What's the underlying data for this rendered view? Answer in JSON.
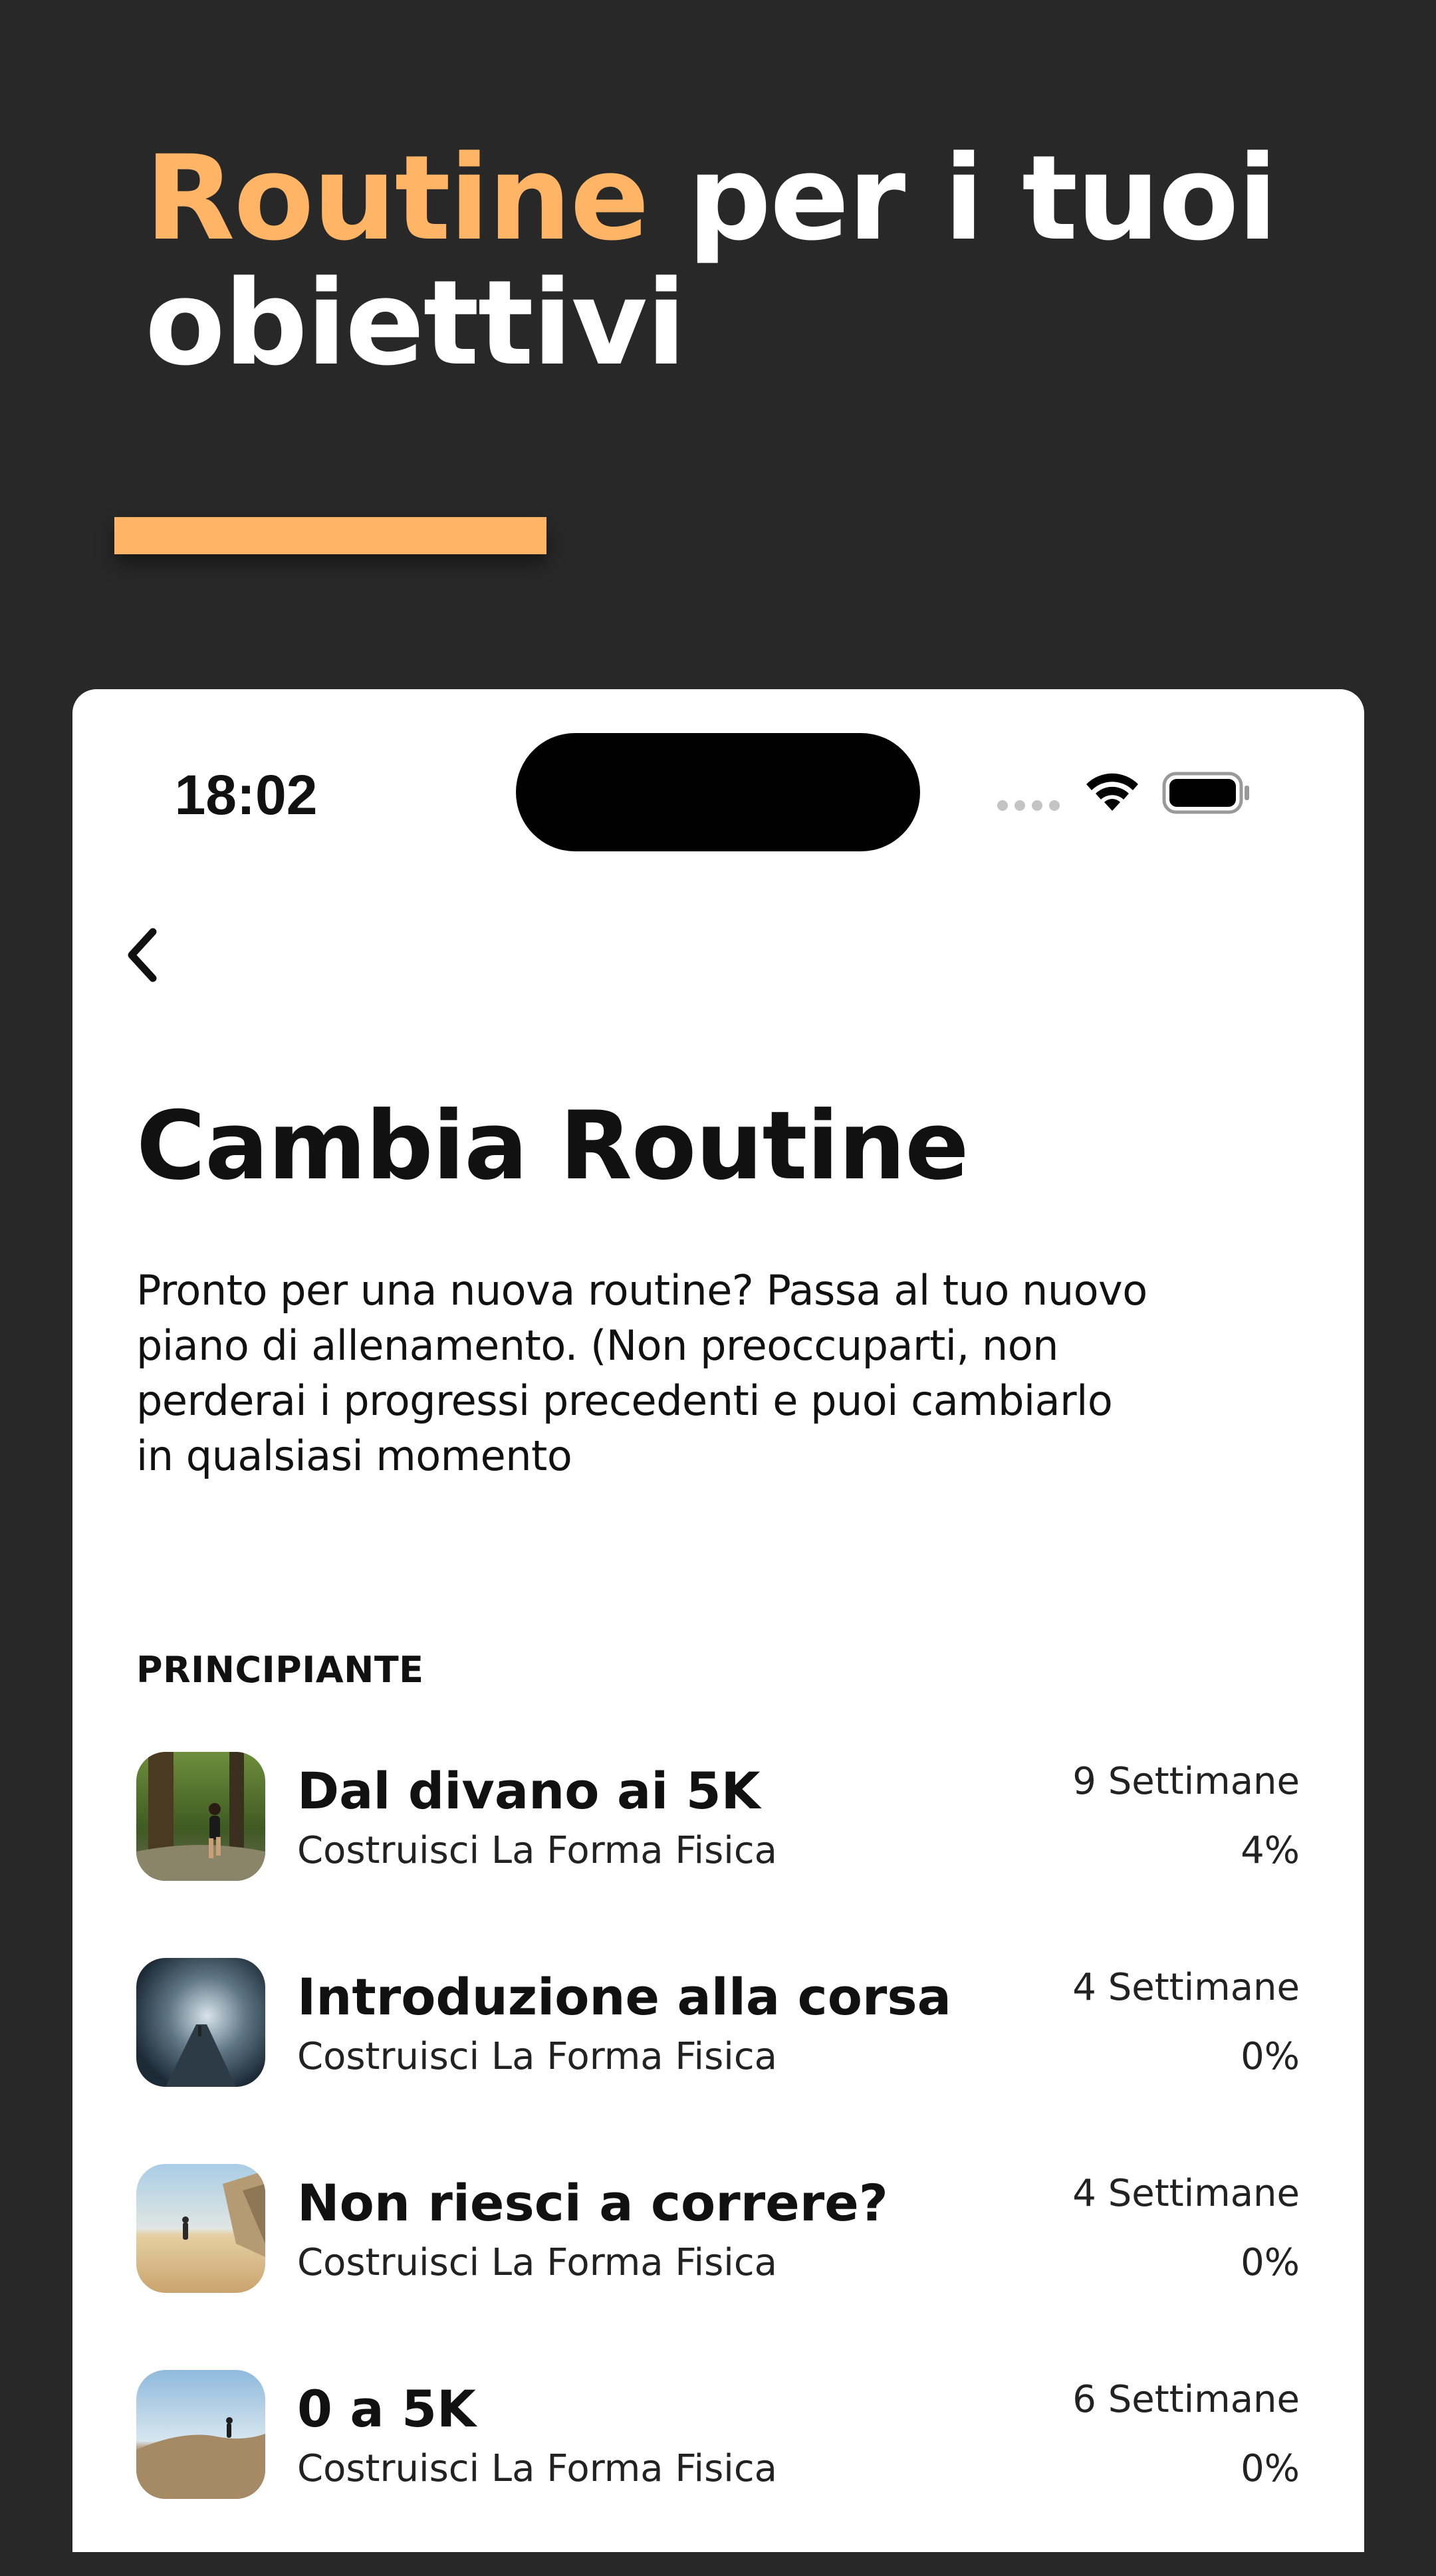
{
  "marketing": {
    "headline_accent": "Routine",
    "headline_rest": " per i tuoi obiettivi",
    "accent_color": "#FFB466",
    "background_color": "#282828"
  },
  "status_bar": {
    "time": "18:02",
    "icons": [
      "signal-icon",
      "wifi-icon",
      "battery-icon"
    ]
  },
  "nav": {
    "back_icon": "chevron-left-icon"
  },
  "page": {
    "title": "Cambia Routine",
    "description": "Pronto per una nuova routine? Passa al tuo nuovo piano di allenamento. (Non preoccuparti, non perderai i progressi precedenti e puoi cambiarlo in qualsiasi momento"
  },
  "section": {
    "label": "PRINCIPIANTE",
    "routines": [
      {
        "name": "Dal divano ai 5K",
        "subtitle": "Costruisci La Forma Fisica",
        "weeks": "9 Settimane",
        "progress": "4%",
        "thumbnail": "forest-runner-photo"
      },
      {
        "name": "Introduzione alla corsa",
        "subtitle": "Costruisci La Forma Fisica",
        "weeks": "4 Settimane",
        "progress": "0%",
        "thumbnail": "misty-road-photo"
      },
      {
        "name": "Non riesci a correre?",
        "subtitle": "Costruisci La Forma Fisica",
        "weeks": "4 Settimane",
        "progress": "0%",
        "thumbnail": "beach-runner-photo"
      },
      {
        "name": "0 a 5K",
        "subtitle": "Costruisci La Forma Fisica",
        "weeks": "6 Settimane",
        "progress": "0%",
        "thumbnail": "hill-runner-photo"
      }
    ]
  }
}
